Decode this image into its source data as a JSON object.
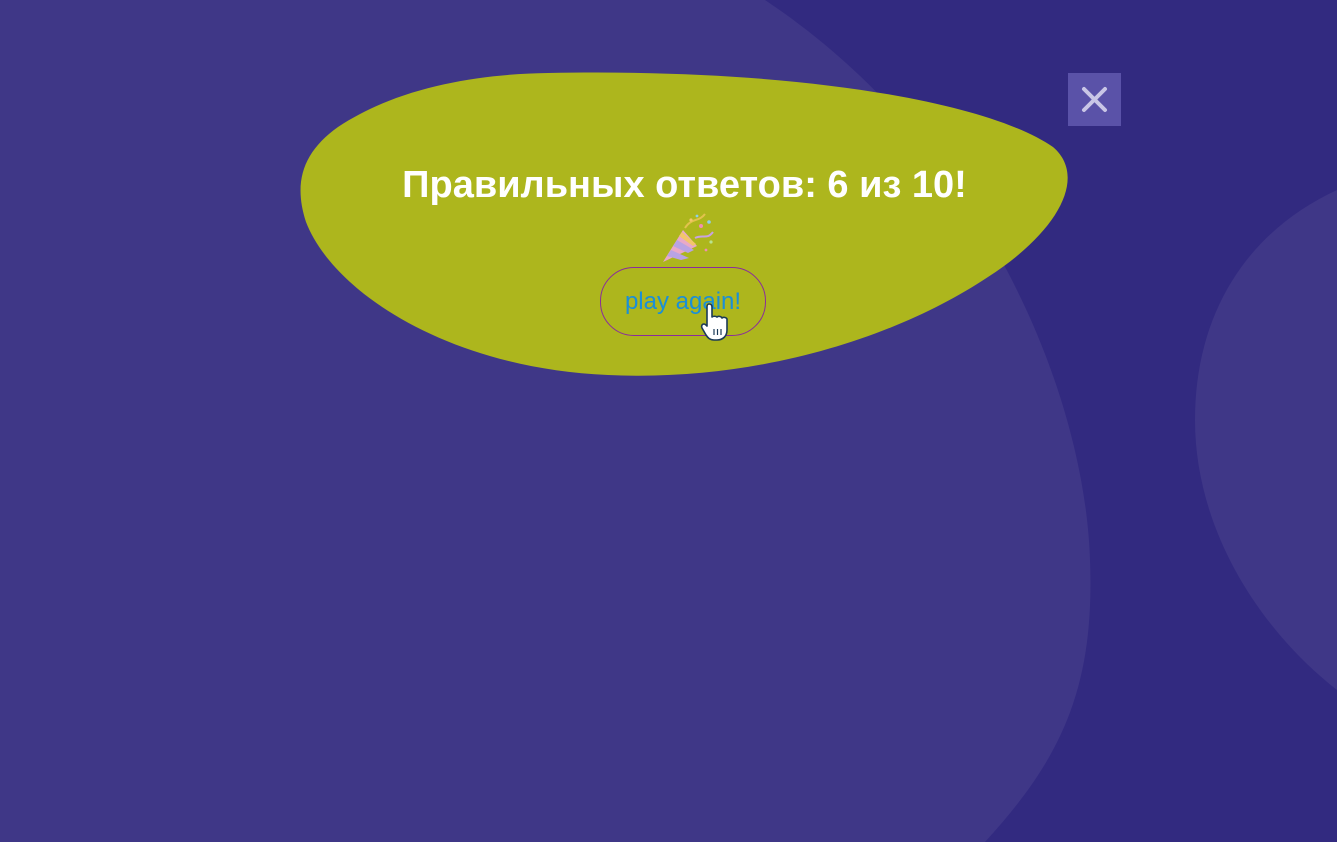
{
  "result": {
    "text": "Правильных ответов: 6 из 10!",
    "emoji": "party-popper-icon"
  },
  "actions": {
    "play_again_label": "play again!",
    "close_icon": "close-icon"
  },
  "cursor": {
    "icon": "hand-pointer-cursor-icon"
  },
  "colors": {
    "background": "#322a80",
    "background_blob": "#3f3787",
    "modal": "#adb61d",
    "result_text": "#ffffff",
    "button_text": "#1a8fd8",
    "button_border": "#8a2c9c",
    "close_button_bg": "#5a52a8",
    "close_icon": "#c9c6e6"
  }
}
